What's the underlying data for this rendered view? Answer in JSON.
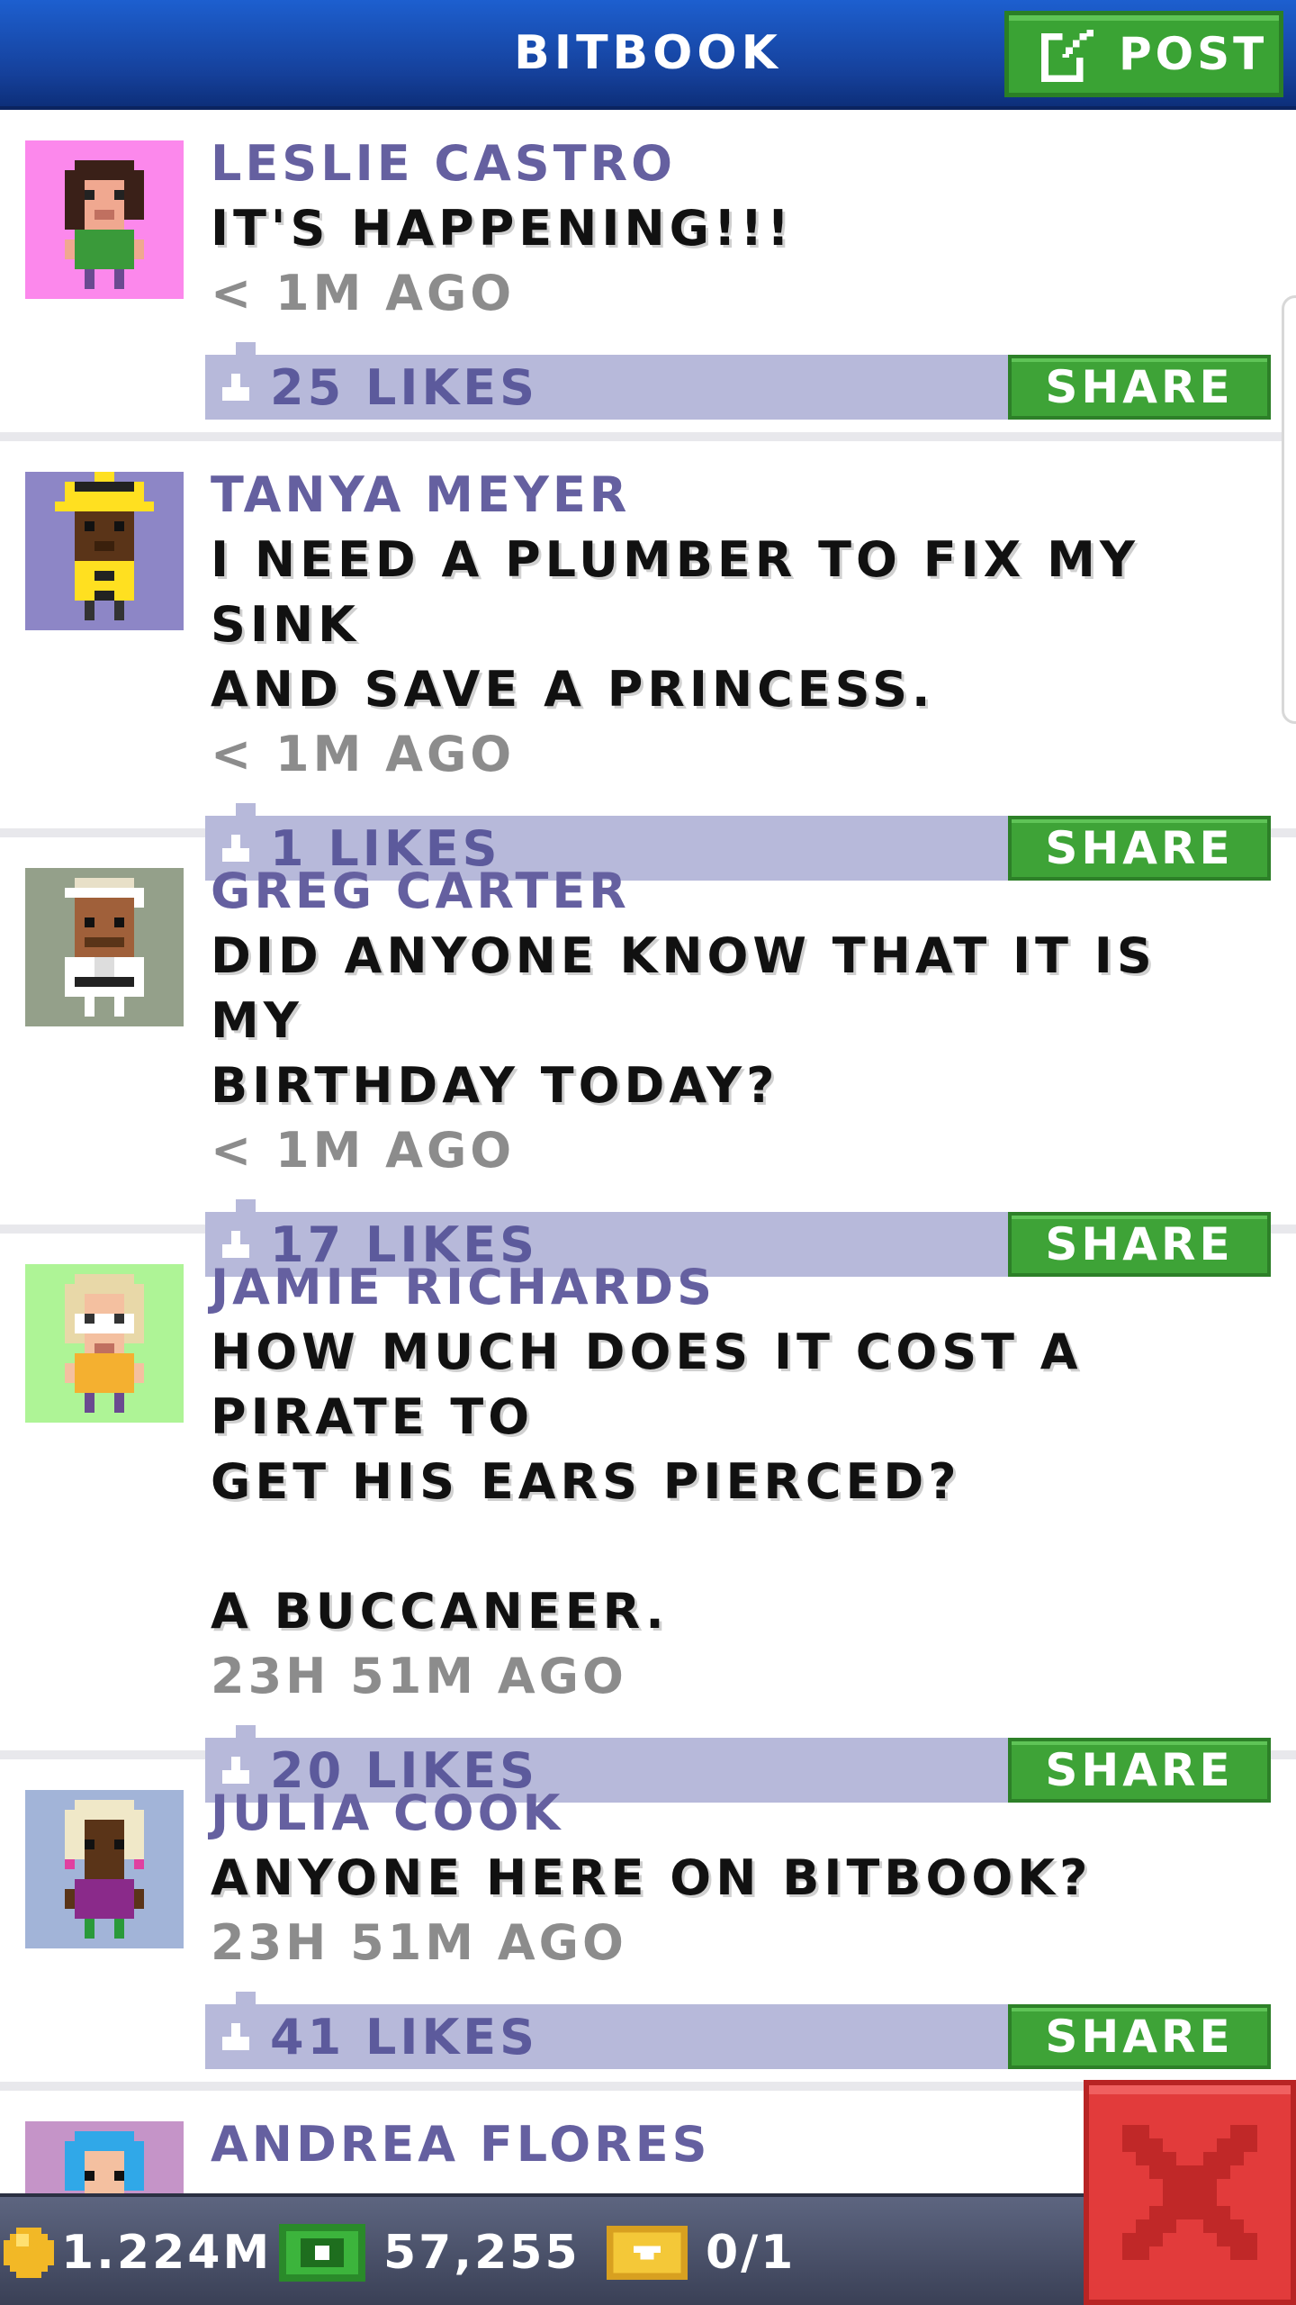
{
  "header": {
    "title": "BITBOOK",
    "post_label": "POST"
  },
  "posts": [
    {
      "author": "LESLIE CASTRO",
      "message": "IT'S HAPPENING!!!",
      "time": "< 1M AGO",
      "likes": "25 LIKES",
      "share_label": "SHARE",
      "avatar_bg": "#fc88ec"
    },
    {
      "author": "TANYA MEYER",
      "message": "I NEED A PLUMBER TO FIX MY SINK\nAND SAVE A PRINCESS.",
      "time": "< 1M AGO",
      "likes": "1 LIKES",
      "share_label": "SHARE",
      "avatar_bg": "#8d86c6"
    },
    {
      "author": "GREG CARTER",
      "message": "DID ANYONE KNOW THAT IT IS MY\nBIRTHDAY TODAY?",
      "time": "< 1M AGO",
      "likes": "17 LIKES",
      "share_label": "SHARE",
      "avatar_bg": "#94a08a"
    },
    {
      "author": "JAMIE RICHARDS",
      "message": "HOW MUCH DOES IT COST A PIRATE TO\nGET HIS EARS PIERCED?\n\nA BUCCANEER.",
      "time": "23H 51M AGO",
      "likes": "20 LIKES",
      "share_label": "SHARE",
      "avatar_bg": "#aef496"
    },
    {
      "author": "JULIA COOK",
      "message": "ANYONE HERE ON BITBOOK?",
      "time": "23H 51M AGO",
      "likes": "41 LIKES",
      "share_label": "SHARE",
      "avatar_bg": "#a2b4d8"
    },
    {
      "author": "ANDREA FLORES",
      "avatar_bg": "#c594c8"
    }
  ],
  "status": {
    "coins": "1.224M",
    "bux": "57,255",
    "tickets": "0/1"
  },
  "colors": {
    "header_blue": "#1d5fcf",
    "accent_green": "#3ea337",
    "like_bar": "#b7b9da",
    "name_purple": "#6560a0",
    "close_red": "#e23b3b"
  }
}
